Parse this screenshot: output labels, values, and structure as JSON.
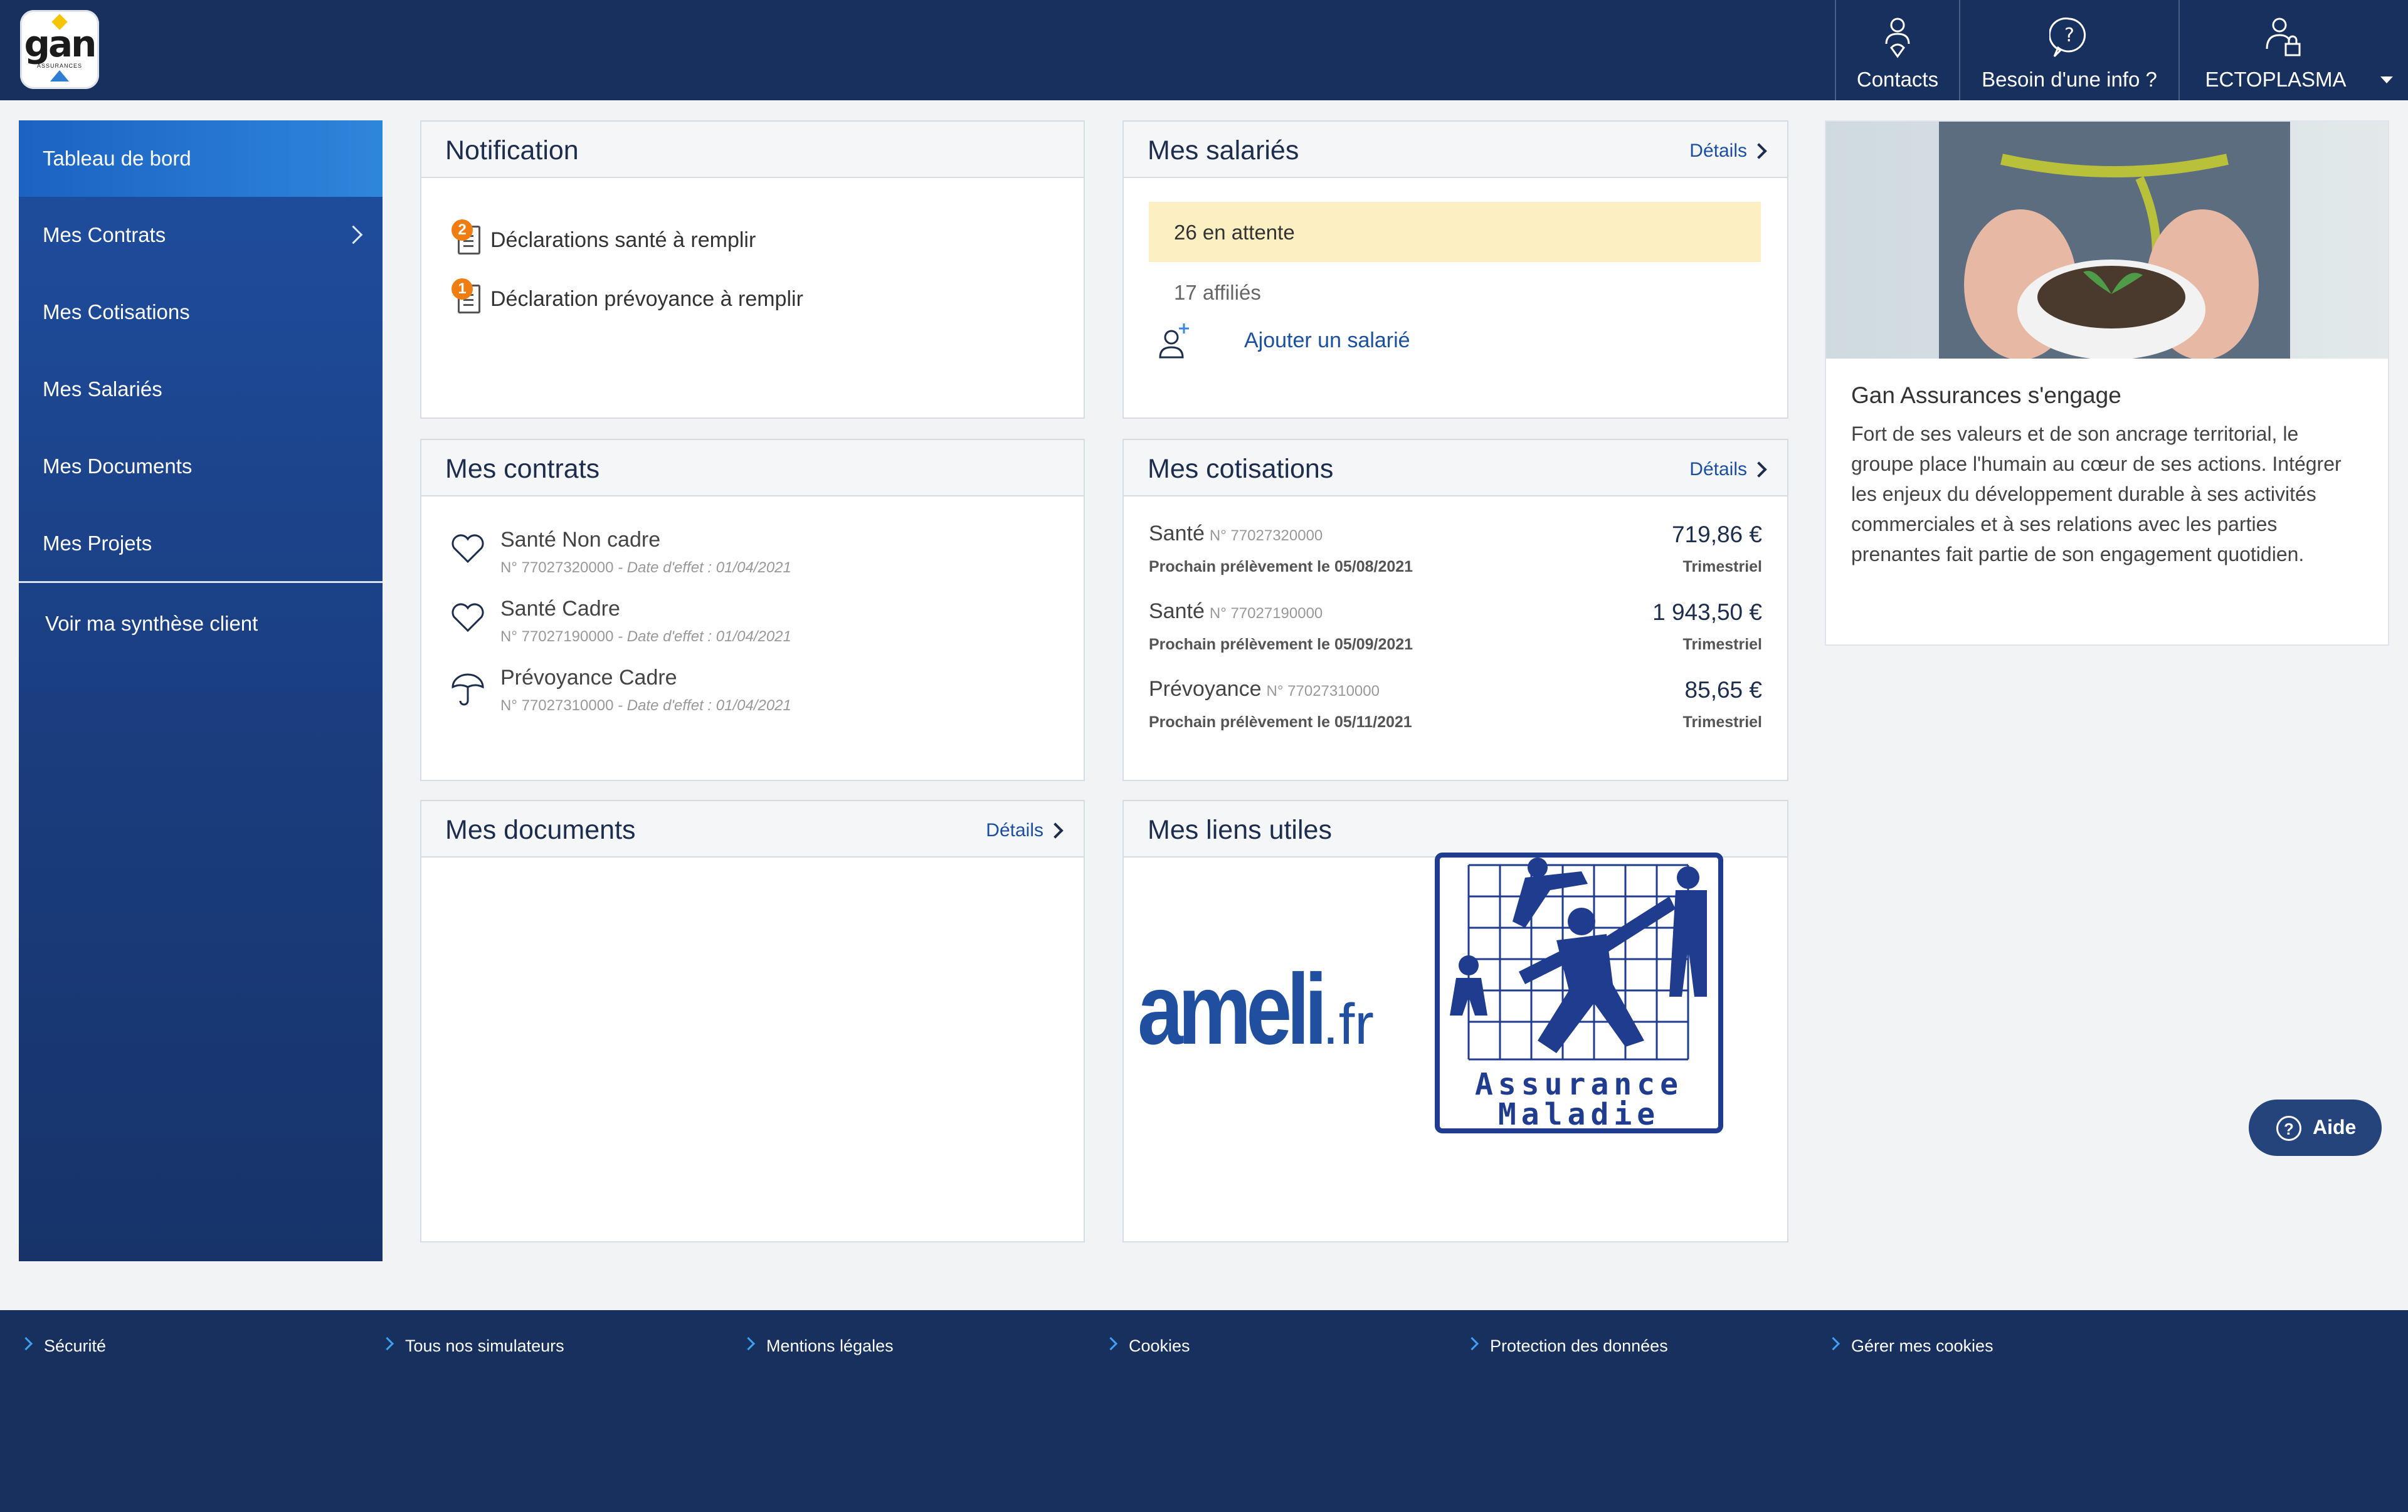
{
  "header": {
    "logo_text": "gan",
    "logo_subtext": "ASSURANCES",
    "nav": [
      {
        "label": "Contacts",
        "icon": "person-pin-icon"
      },
      {
        "label": "Besoin d'une info ?",
        "icon": "question-bubble-icon"
      },
      {
        "label": "ECTOPLASMA",
        "icon": "user-lock-icon"
      }
    ],
    "colors": {
      "navy": "#17305e",
      "accent_blue": "#2e86da",
      "orange": "#f07d11"
    }
  },
  "sidebar": {
    "items": [
      {
        "label": "Tableau de bord",
        "active": true
      },
      {
        "label": "Mes Contrats",
        "has_submenu": true
      },
      {
        "label": "Mes Cotisations"
      },
      {
        "label": "Mes Salariés"
      },
      {
        "label": "Mes Documents"
      },
      {
        "label": "Mes Projets"
      }
    ],
    "client_summary": "Voir ma synthèse client"
  },
  "notification": {
    "title": "Notification",
    "items": [
      {
        "count": "2",
        "label": "Déclarations santé à remplir"
      },
      {
        "count": "1",
        "label": "Déclaration prévoyance à remplir"
      }
    ]
  },
  "salaries": {
    "title": "Mes salariés",
    "details": "Détails",
    "pending": "26 en attente",
    "affiliates": "17 affiliés",
    "add_label": "Ajouter un salarié"
  },
  "contrats": {
    "title": "Mes contrats",
    "items": [
      {
        "name": "Santé Non cadre",
        "number": "N° 77027320000",
        "date": " - Date d'effet : 01/04/2021",
        "icon": "heart-icon"
      },
      {
        "name": "Santé Cadre",
        "number": "N° 77027190000",
        "date": " - Date d'effet : 01/04/2021",
        "icon": "heart-icon"
      },
      {
        "name": "Prévoyance Cadre",
        "number": "N° 77027310000",
        "date": " - Date d'effet : 01/04/2021",
        "icon": "umbrella-icon"
      }
    ]
  },
  "cotisations": {
    "title": "Mes cotisations",
    "details": "Détails",
    "items": [
      {
        "name": "Santé",
        "number": "N° 77027320000",
        "next": "Prochain prélèvement le 05/08/2021",
        "amount": "719,86 €",
        "frequency": "Trimestriel"
      },
      {
        "name": "Santé",
        "number": "N° 77027190000",
        "next": "Prochain prélèvement le 05/09/2021",
        "amount": "1 943,50 €",
        "frequency": "Trimestriel"
      },
      {
        "name": "Prévoyance",
        "number": "N° 77027310000",
        "next": "Prochain prélèvement le 05/11/2021",
        "amount": "85,65 €",
        "frequency": "Trimestriel"
      }
    ]
  },
  "documents": {
    "title": "Mes documents",
    "details": "Détails"
  },
  "liens": {
    "title": "Mes liens utiles",
    "ameli_text": "ameli",
    "ameli_suffix": ".fr",
    "assurance_line1": "Assurance",
    "assurance_line2": "Maladie"
  },
  "promo": {
    "title": "Gan Assurances s'engage",
    "text": "Fort de ses valeurs et de son ancrage territorial, le groupe place l'humain au cœur de ses actions. Intégrer les enjeux du développement durable à ses activités commerciales et à ses relations avec les parties prenantes fait partie de son engagement quotidien."
  },
  "help": {
    "label": "Aide"
  },
  "footer": {
    "links": [
      "Sécurité",
      "Tous nos simulateurs",
      "Mentions légales",
      "Cookies",
      "Protection des données",
      "Gérer mes cookies"
    ]
  }
}
